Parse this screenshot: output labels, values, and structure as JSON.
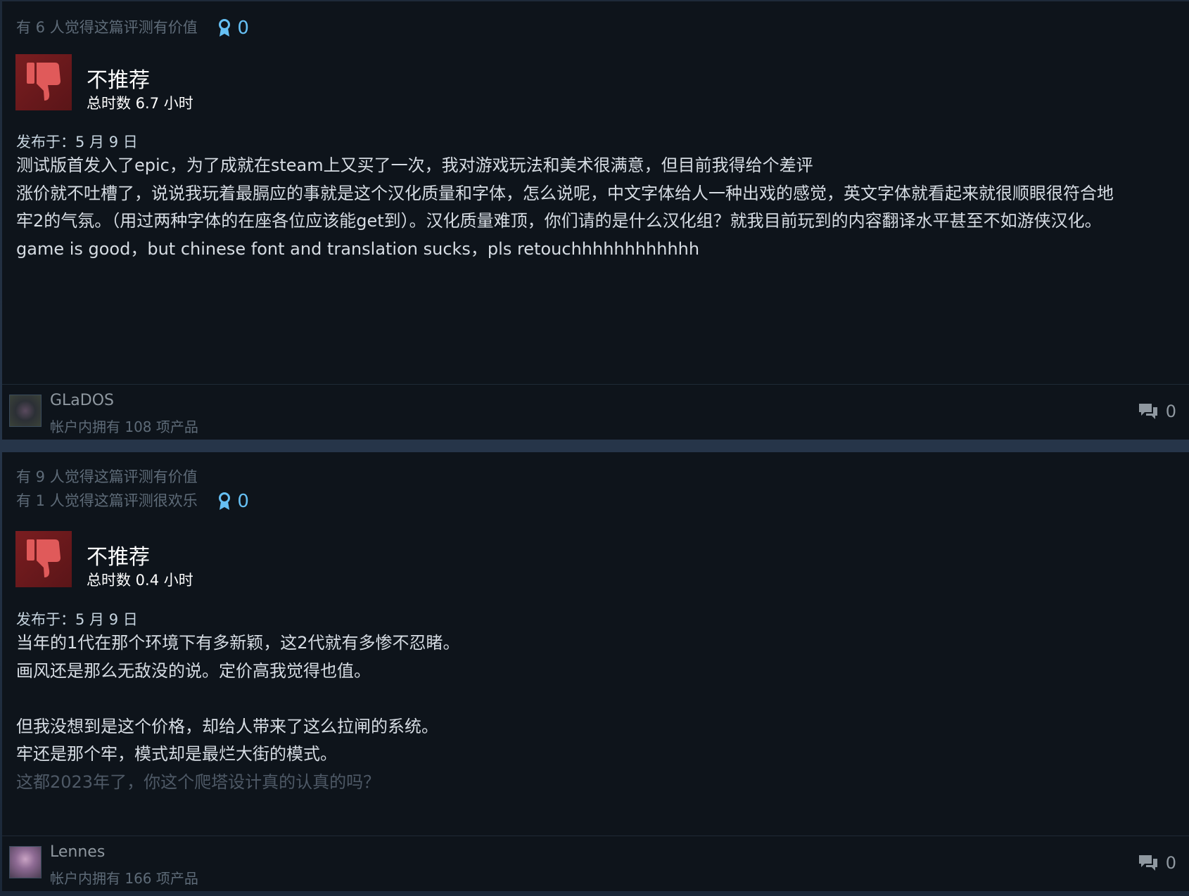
{
  "reviews": [
    {
      "helpful_lines": [
        "有 6 人觉得这篇评测有价值"
      ],
      "award_count": "0",
      "verdict": "不推荐",
      "hours": "总时数 6.7 小时",
      "posted": "发布于：5 月 9 日",
      "body_lines": [
        "测试版首发入了epic，为了成就在steam上又买了一次，我对游戏玩法和美术很满意，但目前我得给个差评",
        "涨价就不吐槽了，说说我玩着最膈应的事就是这个汉化质量和字体，怎么说呢，中文字体给人一种出戏的感觉，英文字体就看起来就很顺眼很符合地",
        "牢2的气氛。（用过两种字体的在座各位应该能get到）。汉化质量难顶，你们请的是什么汉化组？就我目前玩到的内容翻译水平甚至不如游侠汉化。",
        "game is good，but chinese font and translation sucks，pls retouchhhhhhhhhhhh"
      ],
      "author": "GLaDOS",
      "products": "帐户内拥有 108 项产品",
      "comment_count": "0"
    },
    {
      "helpful_lines": [
        "有 9 人觉得这篇评测有价值",
        "有 1 人觉得这篇评测很欢乐"
      ],
      "award_count": "0",
      "verdict": "不推荐",
      "hours": "总时数 0.4 小时",
      "posted": "发布于：5 月 9 日",
      "body_lines": [
        "当年的1代在那个环境下有多新颖，这2代就有多惨不忍睹。",
        "画风还是那么无敌没的说。定价高我觉得也值。",
        "",
        "但我没想到是这个价格，却给人带来了这么拉闸的系统。",
        "牢还是那个牢，模式却是最烂大街的模式。",
        "这都2023年了，你这个爬塔设计真的认真的吗？"
      ],
      "author": "Lennes",
      "products": "帐户内拥有 166 项产品",
      "comment_count": "0"
    }
  ],
  "icons": {
    "thumb": "thumbs-down-icon",
    "award": "award-ribbon-icon",
    "comment": "comment-bubble-icon"
  },
  "colors": {
    "card_bg": "#0e141b",
    "thumb_bg": "#7a1d20",
    "thumb_icon": "#e05a5a",
    "award_blue": "#66c0f4",
    "muted_text": "#5e6b78",
    "body_text": "#d6dce3"
  }
}
